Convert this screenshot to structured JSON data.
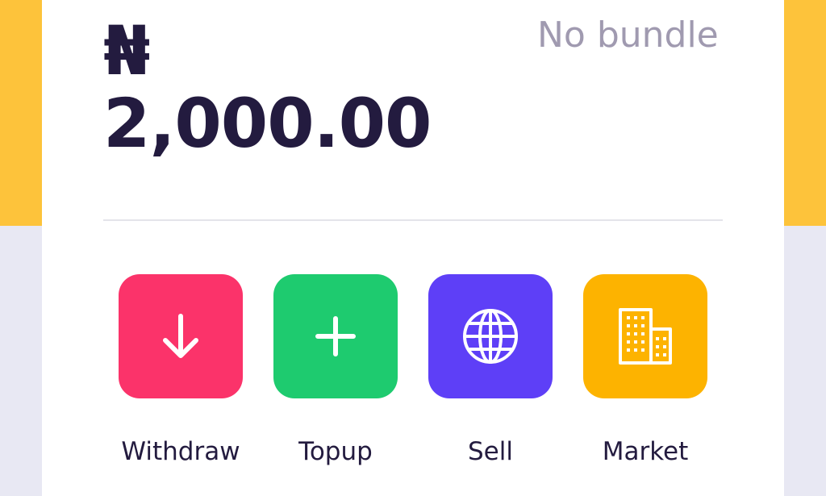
{
  "balance": {
    "currency": "₦",
    "amount": "2,000.00"
  },
  "bundle": {
    "status": "No bundle"
  },
  "actions": [
    {
      "label": "Withdraw",
      "icon": "arrow-down-icon",
      "color": "#fb336a"
    },
    {
      "label": "Topup",
      "icon": "plus-icon",
      "color": "#1ecb6f"
    },
    {
      "label": "Sell",
      "icon": "globe-icon",
      "color": "#5e3ff7"
    },
    {
      "label": "Market",
      "icon": "building-icon",
      "color": "#fdb300"
    }
  ],
  "colors": {
    "header": "#fdc33b",
    "page": "#e8e8f3",
    "card": "#ffffff",
    "text": "#231b3f",
    "muted": "#a09ab0"
  }
}
